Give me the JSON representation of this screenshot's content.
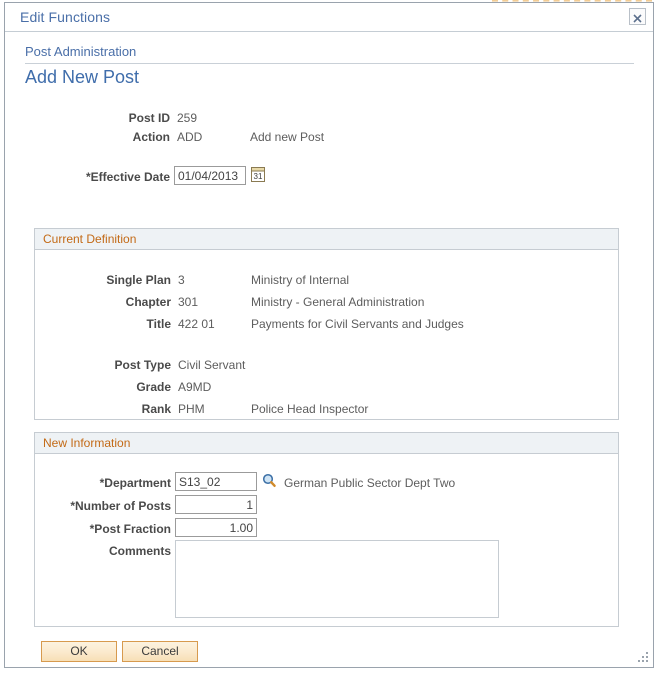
{
  "window": {
    "title": "Edit Functions",
    "close_icon": "close-icon"
  },
  "header": {
    "breadcrumb": "Post Administration",
    "page_title": "Add New Post"
  },
  "top_fields": [
    {
      "label": "Post ID",
      "value": "259",
      "description": ""
    },
    {
      "label": "Action",
      "value": "ADD",
      "description": "Add new Post"
    }
  ],
  "effective_date": {
    "label": "*Effective Date",
    "value": "01/04/2013",
    "calendar_icon": "calendar-icon",
    "calendar_day": "31"
  },
  "current_definition": {
    "title": "Current Definition",
    "rows": [
      {
        "label": "Single Plan",
        "value": "3",
        "description": "Ministry of Internal"
      },
      {
        "label": "Chapter",
        "value": "301",
        "description": "Ministry - General Administration"
      },
      {
        "label": "Title",
        "value": "422 01",
        "description": "Payments for Civil Servants and Judges"
      },
      {
        "label": "Post Type",
        "value": "Civil Servant",
        "description": ""
      },
      {
        "label": "Grade",
        "value": "A9MD",
        "description": ""
      },
      {
        "label": "Rank",
        "value": "PHM",
        "description": "Police Head Inspector"
      }
    ]
  },
  "new_information": {
    "title": "New Information",
    "department": {
      "label": "*Department",
      "value": "S13_02",
      "description": "German Public Sector Dept Two",
      "lookup_icon": "search-lookup-icon"
    },
    "number_of_posts": {
      "label": "*Number of Posts",
      "value": "1"
    },
    "post_fraction": {
      "label": "*Post Fraction",
      "value": "1.00"
    },
    "comments": {
      "label": "Comments",
      "value": "",
      "placeholder": ""
    }
  },
  "actions": {
    "ok_label": "OK",
    "cancel_label": "Cancel"
  },
  "colors": {
    "link_blue": "#4a6fa8",
    "title_blue": "#3f6dab",
    "group_header_text": "#c36a16",
    "group_header_bg": "#eef2f5",
    "button_border": "#d79a4e",
    "label_gray": "#4a4a4a",
    "value_gray": "#5d5d5d",
    "border_gray": "#c6ccd2"
  }
}
